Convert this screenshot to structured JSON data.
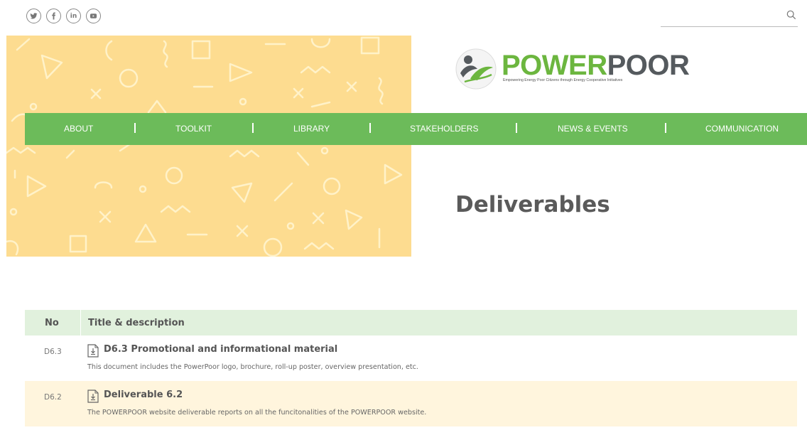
{
  "social": {
    "icons": [
      "twitter-icon",
      "facebook-icon",
      "linkedin-icon",
      "youtube-icon"
    ],
    "linkedin_label": "in"
  },
  "search": {
    "value": "",
    "placeholder": ""
  },
  "logo": {
    "word_power": "POWER",
    "word_poor": "POOR",
    "tagline": "Empowering Energy Poor Citizens through Energy Cooperative Initiatives"
  },
  "nav": {
    "items": [
      "ABOUT",
      "TOOLKIT",
      "LIBRARY",
      "STAKEHOLDERS",
      "NEWS & EVENTS",
      "COMMUNICATION"
    ]
  },
  "page": {
    "title": "Deliverables"
  },
  "table": {
    "headers": [
      "No",
      "Title & description"
    ],
    "rows": [
      {
        "no": "D6.3",
        "title": "D6.3 Promotional and informational material",
        "description": "This document includes the PowerPoor logo, brochure, roll-up poster, overview presentation, etc."
      },
      {
        "no": "D6.2",
        "title": "Deliverable 6.2",
        "description": "The POWERPOOR website deliverable reports on all the funcitonalities of the POWERPOOR website."
      }
    ]
  },
  "colors": {
    "brand_green": "#6cb63f",
    "nav_green": "#6cbb5a",
    "banner_yellow": "#fddc90",
    "header_row": "#e1f1dd",
    "alt_row": "#fff5dd"
  }
}
